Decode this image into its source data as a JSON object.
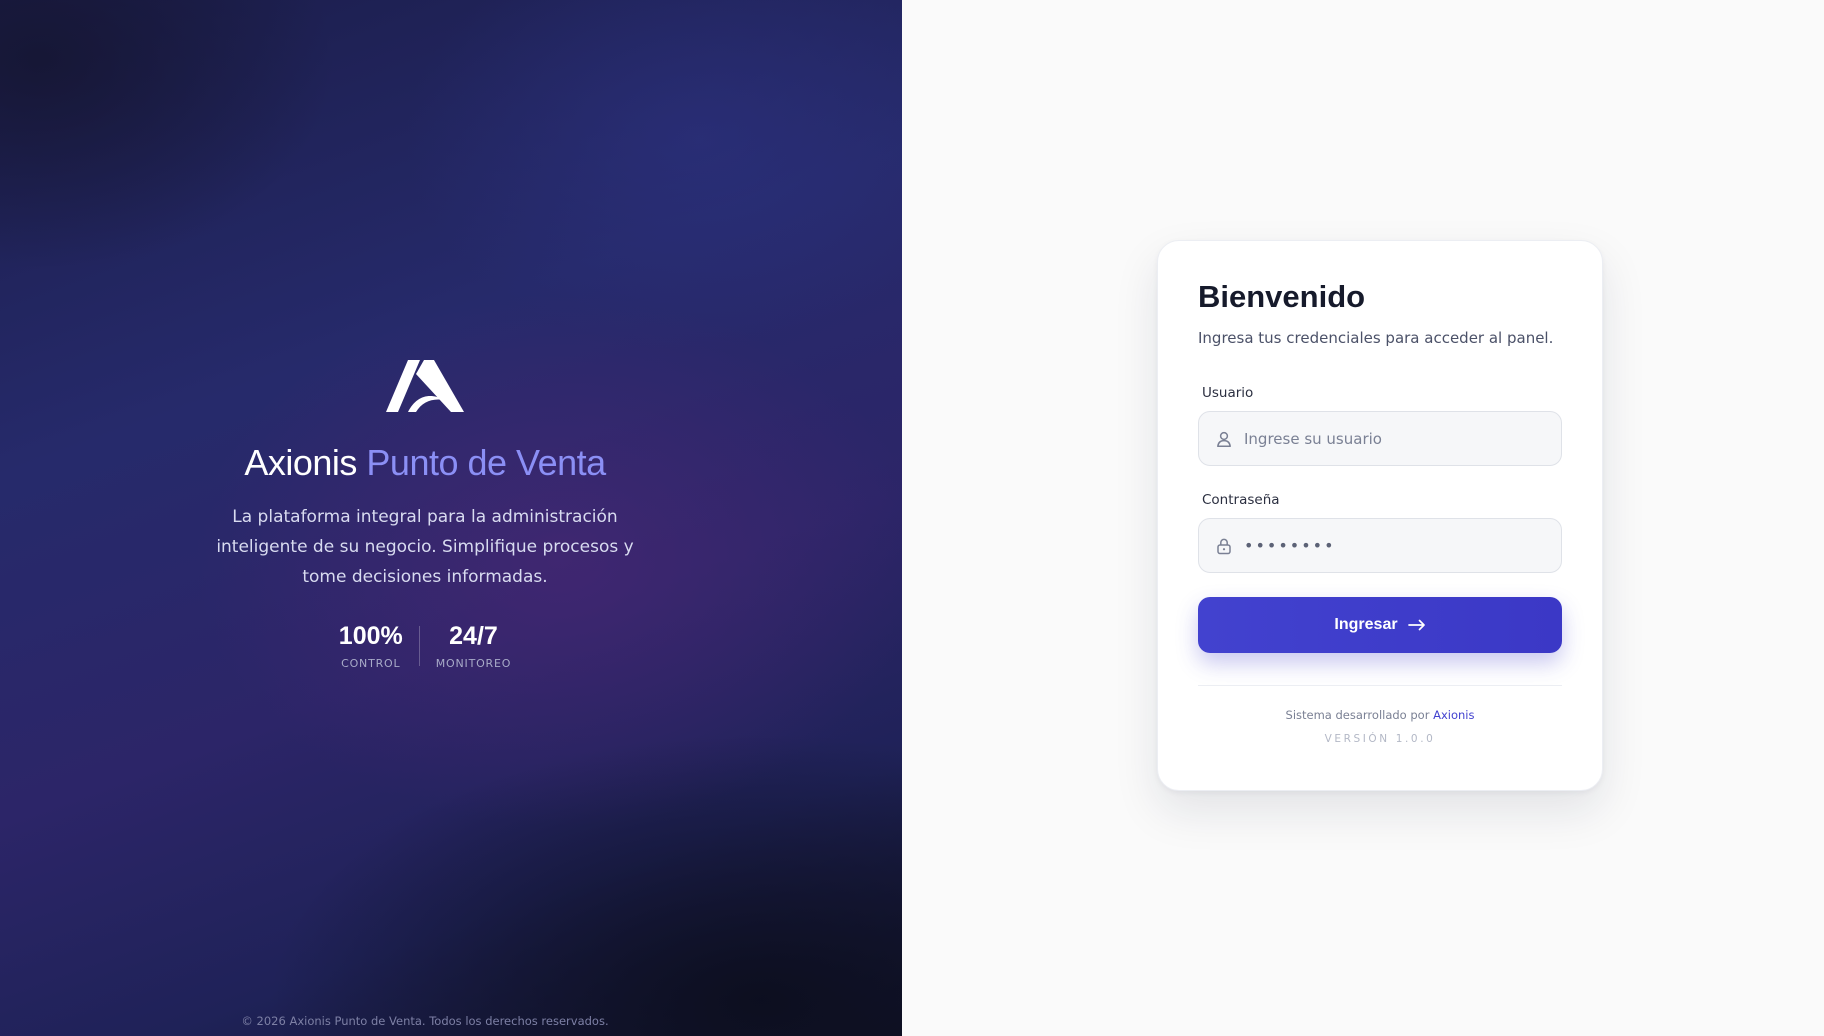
{
  "colors": {
    "accent": "#4242cf",
    "brand_accent": "#8b8ff5",
    "hero_background": "#1f2258"
  },
  "hero": {
    "logo_icon": "axionis-logo-icon",
    "title_main": "Axionis",
    "title_accent": "Punto de Venta",
    "description": "La plataforma integral para la administración inteligente de su negocio. Simplifique procesos y tome decisiones informadas.",
    "stats": [
      {
        "value": "100%",
        "label": "CONTROL"
      },
      {
        "value": "24/7",
        "label": "MONITOREO"
      }
    ],
    "footer": "© 2026 Axionis Punto de Venta. Todos los derechos reservados."
  },
  "login": {
    "title": "Bienvenido",
    "subtitle": "Ingresa tus credenciales para acceder al panel.",
    "username": {
      "label": "Usuario",
      "placeholder": "Ingrese su usuario",
      "value": "",
      "icon": "user-icon"
    },
    "password": {
      "label": "Contraseña",
      "value": "••••••••",
      "icon": "lock-icon"
    },
    "submit": {
      "label": "Ingresar",
      "icon": "arrow-right-icon"
    },
    "credits_text": "Sistema desarrollado por",
    "credits_link": "Axionis",
    "version": "VERSIÓN 1.0.0"
  }
}
